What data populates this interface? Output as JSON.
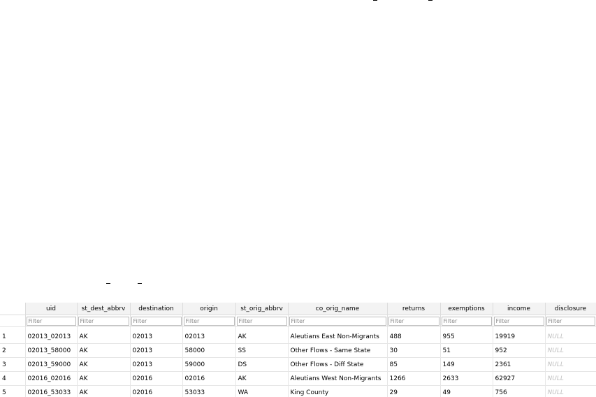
{
  "grid": {
    "columns": [
      {
        "key": "uid",
        "label": "uid"
      },
      {
        "key": "st_dest_abbrv",
        "label": "st_dest_abbrv"
      },
      {
        "key": "destination",
        "label": "destination"
      },
      {
        "key": "origin",
        "label": "origin"
      },
      {
        "key": "st_orig_abbrv",
        "label": "st_orig_abbrv"
      },
      {
        "key": "co_orig_name",
        "label": "co_orig_name"
      },
      {
        "key": "returns",
        "label": "returns"
      },
      {
        "key": "exemptions",
        "label": "exemptions"
      },
      {
        "key": "income",
        "label": "income"
      },
      {
        "key": "disclosure",
        "label": "disclosure"
      }
    ],
    "filter_placeholder": "Filter",
    "rows": [
      {
        "num": "1",
        "cells": [
          "02013_02013",
          "AK",
          "02013",
          "02013",
          "AK",
          "Aleutians East Non-Migrants",
          "488",
          "955",
          "19919",
          "NULL"
        ]
      },
      {
        "num": "2",
        "cells": [
          "02013_58000",
          "AK",
          "02013",
          "58000",
          "SS",
          "Other Flows - Same State",
          "30",
          "51",
          "952",
          "NULL"
        ]
      },
      {
        "num": "3",
        "cells": [
          "02013_59000",
          "AK",
          "02013",
          "59000",
          "DS",
          "Other Flows - Diff State",
          "85",
          "149",
          "2361",
          "NULL"
        ]
      },
      {
        "num": "4",
        "cells": [
          "02016_02016",
          "AK",
          "02016",
          "02016",
          "AK",
          "Aleutians West Non-Migrants",
          "1266",
          "2633",
          "62927",
          "NULL"
        ]
      },
      {
        "num": "5",
        "cells": [
          "02016_53033",
          "AK",
          "02016",
          "53033",
          "WA",
          "King County",
          "29",
          "49",
          "756",
          "NULL"
        ]
      }
    ]
  }
}
